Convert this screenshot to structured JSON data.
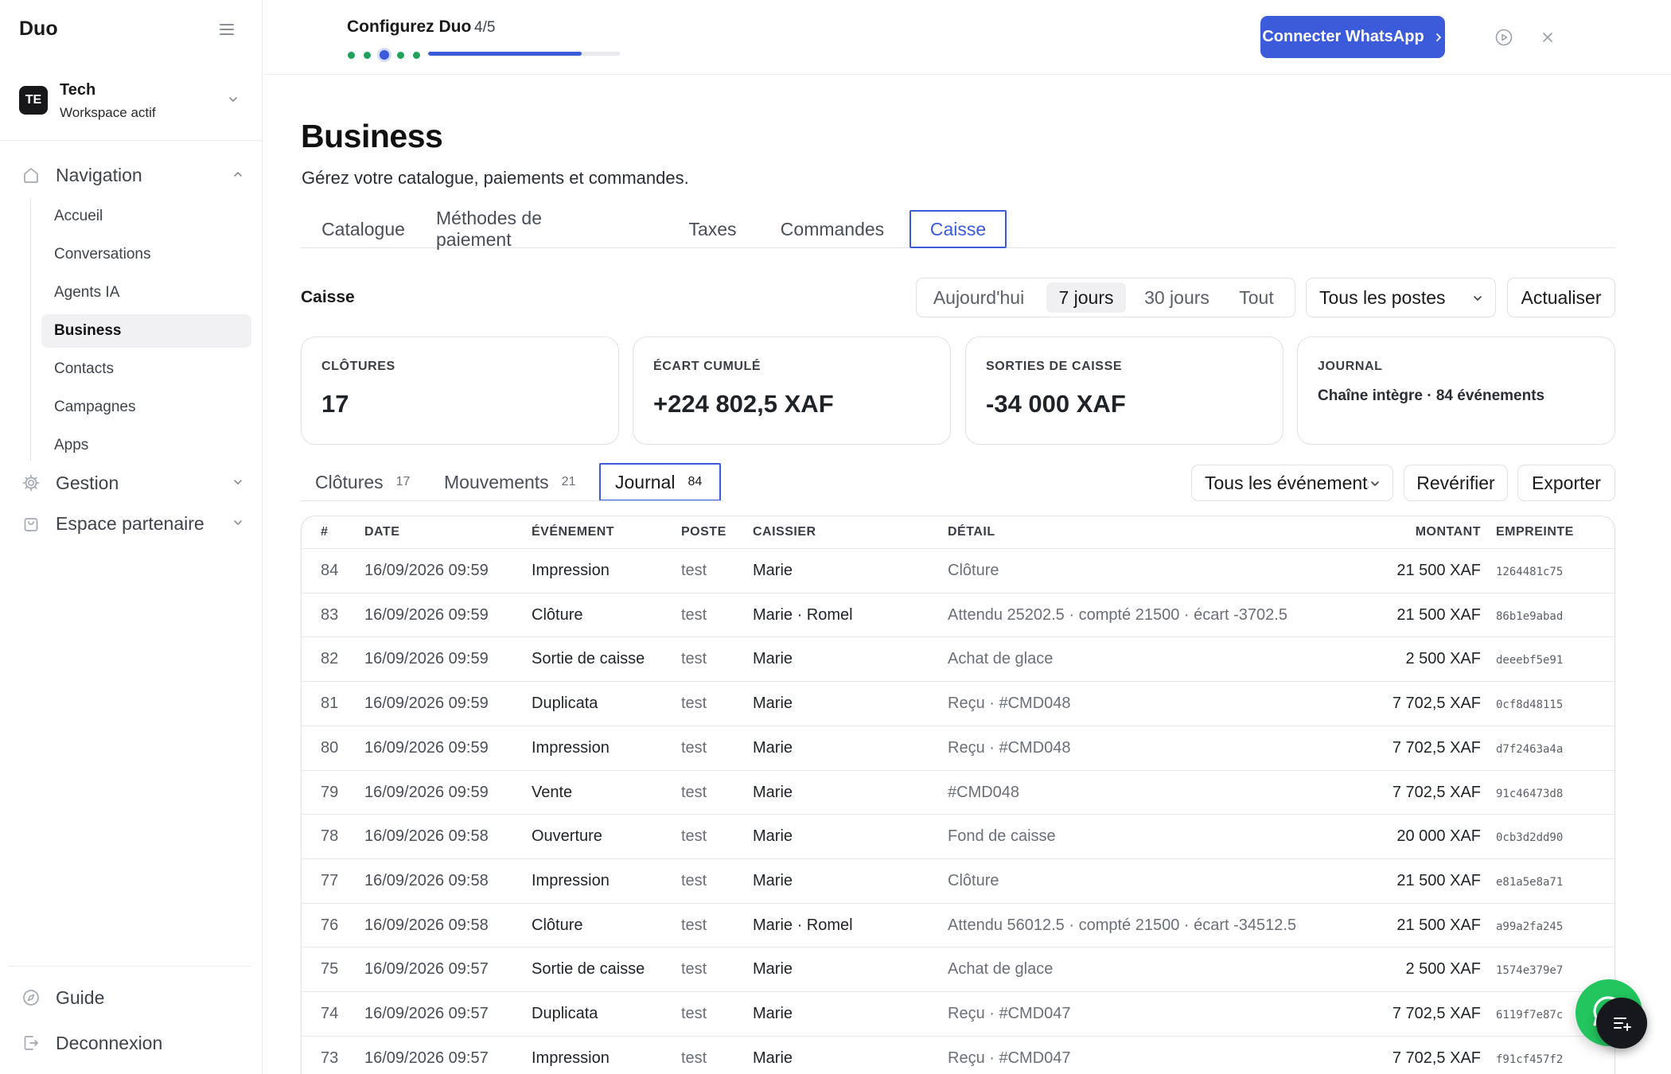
{
  "sidebar": {
    "brand": "Duo",
    "workspace": {
      "initials": "TE",
      "name": "Tech",
      "subtitle": "Workspace actif"
    },
    "groups": [
      {
        "label": "Navigation",
        "icon": "home-icon"
      },
      {
        "label": "Gestion",
        "icon": "gear-icon"
      },
      {
        "label": "Espace partenaire",
        "icon": "bag-icon"
      }
    ],
    "items": [
      {
        "label": "Accueil"
      },
      {
        "label": "Conversations"
      },
      {
        "label": "Agents IA"
      },
      {
        "label": "Business",
        "active": true
      },
      {
        "label": "Contacts"
      },
      {
        "label": "Campagnes"
      },
      {
        "label": "Apps"
      }
    ],
    "footer": [
      {
        "label": "Guide",
        "icon": "compass-icon"
      },
      {
        "label": "Deconnexion",
        "icon": "logout-icon"
      }
    ]
  },
  "topbar": {
    "setup_title": "Configurez Duo",
    "setup_step": "4/5",
    "progress": 0.8,
    "cta_label": "Connecter WhatsApp"
  },
  "page": {
    "title": "Business",
    "subtitle": "Gérez votre catalogue, paiements et commandes.",
    "tabs": [
      "Catalogue",
      "Méthodes de paiement",
      "Taxes",
      "Commandes",
      "Caisse"
    ],
    "active_tab": "Caisse"
  },
  "caisse": {
    "label": "Caisse",
    "periods": [
      "Aujourd'hui",
      "7 jours",
      "30 jours",
      "Tout"
    ],
    "active_period": "7 jours",
    "poste_select": "Tous les postes",
    "refresh_label": "Actualiser",
    "stats": [
      {
        "label": "CLÔTURES",
        "value": "17"
      },
      {
        "label": "ÉCART CUMULÉ",
        "value": "+224 802,5 XAF"
      },
      {
        "label": "SORTIES DE CAISSE",
        "value": "-34 000 XAF"
      },
      {
        "label": "JOURNAL",
        "value": "Chaîne intègre · 84 événements"
      }
    ],
    "subtabs": [
      {
        "label": "Clôtures",
        "count": "17"
      },
      {
        "label": "Mouvements",
        "count": "21"
      },
      {
        "label": "Journal",
        "count": "84",
        "active": true
      }
    ],
    "event_select": "Tous les événements",
    "reverify_label": "Revérifier",
    "export_label": "Exporter"
  },
  "journal": {
    "columns": [
      "#",
      "DATE",
      "ÉVÉNEMENT",
      "POSTE",
      "CAISSIER",
      "DÉTAIL",
      "MONTANT",
      "EMPREINTE"
    ],
    "rows": [
      {
        "num": "84",
        "date": "16/09/2026 09:59",
        "event": "Impression",
        "poste": "test",
        "caissier": "Marie",
        "detail": "Clôture",
        "montant": "21 500 XAF",
        "hash": "1264481c75"
      },
      {
        "num": "83",
        "date": "16/09/2026 09:59",
        "event": "Clôture",
        "poste": "test",
        "caissier": "Marie · Romel",
        "detail": "Attendu 25202.5 · compté 21500 · écart -3702.5",
        "montant": "21 500 XAF",
        "hash": "86b1e9abad"
      },
      {
        "num": "82",
        "date": "16/09/2026 09:59",
        "event": "Sortie de caisse",
        "poste": "test",
        "caissier": "Marie",
        "detail": "Achat de glace",
        "montant": "2 500 XAF",
        "hash": "deeebf5e91"
      },
      {
        "num": "81",
        "date": "16/09/2026 09:59",
        "event": "Duplicata",
        "poste": "test",
        "caissier": "Marie",
        "detail": "Reçu · #CMD048",
        "montant": "7 702,5 XAF",
        "hash": "0cf8d48115"
      },
      {
        "num": "80",
        "date": "16/09/2026 09:59",
        "event": "Impression",
        "poste": "test",
        "caissier": "Marie",
        "detail": "Reçu · #CMD048",
        "montant": "7 702,5 XAF",
        "hash": "d7f2463a4a"
      },
      {
        "num": "79",
        "date": "16/09/2026 09:59",
        "event": "Vente",
        "poste": "test",
        "caissier": "Marie",
        "detail": "#CMD048",
        "montant": "7 702,5 XAF",
        "hash": "91c46473d8"
      },
      {
        "num": "78",
        "date": "16/09/2026 09:58",
        "event": "Ouverture",
        "poste": "test",
        "caissier": "Marie",
        "detail": "Fond de caisse",
        "montant": "20 000 XAF",
        "hash": "0cb3d2dd90"
      },
      {
        "num": "77",
        "date": "16/09/2026 09:58",
        "event": "Impression",
        "poste": "test",
        "caissier": "Marie",
        "detail": "Clôture",
        "montant": "21 500 XAF",
        "hash": "e81a5e8a71"
      },
      {
        "num": "76",
        "date": "16/09/2026 09:58",
        "event": "Clôture",
        "poste": "test",
        "caissier": "Marie · Romel",
        "detail": "Attendu 56012.5 · compté 21500 · écart -34512.5",
        "montant": "21 500 XAF",
        "hash": "a99a2fa245"
      },
      {
        "num": "75",
        "date": "16/09/2026 09:57",
        "event": "Sortie de caisse",
        "poste": "test",
        "caissier": "Marie",
        "detail": "Achat de glace",
        "montant": "2 500 XAF",
        "hash": "1574e379e7"
      },
      {
        "num": "74",
        "date": "16/09/2026 09:57",
        "event": "Duplicata",
        "poste": "test",
        "caissier": "Marie",
        "detail": "Reçu · #CMD047",
        "montant": "7 702,5 XAF",
        "hash": "6119f7e87c"
      },
      {
        "num": "73",
        "date": "16/09/2026 09:57",
        "event": "Impression",
        "poste": "test",
        "caissier": "Marie",
        "detail": "Reçu · #CMD047",
        "montant": "7 702,5 XAF",
        "hash": "f91cf457f2"
      }
    ]
  },
  "colors": {
    "accent": "#3b5bdb",
    "success": "#22c55e",
    "dark": "#16181d"
  }
}
